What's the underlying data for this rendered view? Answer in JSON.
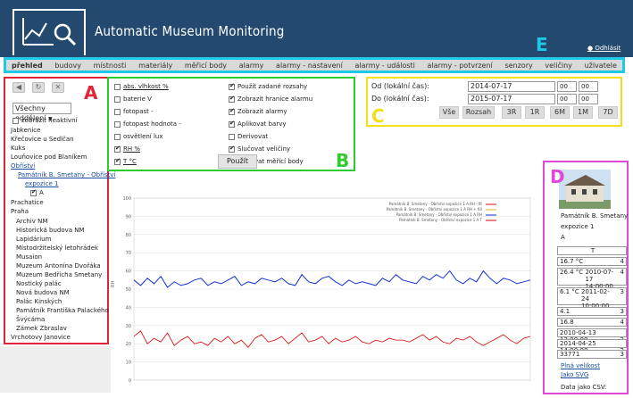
{
  "app": {
    "title": "Automatic Museum Monitoring",
    "logout": "Odhlásit"
  },
  "nav": {
    "items": [
      {
        "label": "přehled",
        "active": true
      },
      {
        "label": "budovy"
      },
      {
        "label": "místnosti"
      },
      {
        "label": "materiály"
      },
      {
        "label": "měřicí body"
      },
      {
        "label": "alarmy"
      },
      {
        "label": "alarmy - nastavení"
      },
      {
        "label": "alarmy - události"
      },
      {
        "label": "alarmy - potvrzení"
      },
      {
        "label": "senzory"
      },
      {
        "label": "veličiny"
      },
      {
        "label": "uživatele"
      }
    ]
  },
  "markers": {
    "a": "A",
    "b": "B",
    "c": "C",
    "d": "D",
    "e": "E"
  },
  "marker_colors": {
    "a": "#e0243a",
    "b": "#2ecc2e",
    "c": "#f2e016",
    "d": "#e04ad8",
    "e": "#1ec8e6"
  },
  "sidebar": {
    "select": "Všechny oddělení",
    "show_inactive": "zobrazit neaktivní",
    "tree": [
      "Jabkenice",
      "Křečovice u Sedlčan",
      "Kuks",
      "Louňovice pod Blaníkem",
      "Obříství",
      "Památník B. Smetany - Obříství",
      "expozice 1",
      "A",
      "Prachatice",
      "Praha",
      "Archiv NM",
      "Historická budova NM",
      "Lapidárium",
      "Místodržitelský letohrádek",
      "Musaion",
      "Muzeum Antonína Dvořáka",
      "Muzeum Bedřicha Smetany",
      "Nostický palác",
      "Nová budova NM",
      "Palác Kinských",
      "Památník Františka Palackého",
      "Švýcárna",
      "Zámek Zbraslav",
      "Vrchotovy Janovice"
    ]
  },
  "options": {
    "left": [
      {
        "label": "abs. vlhkost %",
        "checked": false
      },
      {
        "label": "baterie V",
        "checked": false
      },
      {
        "label": "fotopast -",
        "checked": false
      },
      {
        "label": "fotopast hodnota -",
        "checked": false
      },
      {
        "label": "osvětlení lux",
        "checked": false
      },
      {
        "label": "RH %",
        "checked": true
      },
      {
        "label": "T °C",
        "checked": true
      }
    ],
    "right": [
      {
        "label": "Použít zadané rozsahy",
        "checked": true
      },
      {
        "label": "Zobrazit hranice alarmu",
        "checked": true
      },
      {
        "label": "Zobrazit alarmy",
        "checked": true
      },
      {
        "label": "Aplikovat barvy",
        "checked": true
      },
      {
        "label": "Derivovat",
        "checked": false
      },
      {
        "label": "Slučovat veličiny",
        "checked": true
      },
      {
        "label": "Slučovat měřicí body",
        "checked": true
      }
    ],
    "apply": "Použít"
  },
  "daterange": {
    "from_label": "Od (lokální čas):",
    "to_label": "Do (lokální čas):",
    "from": "2014-07-17",
    "to": "2015-07-17",
    "hour": "00",
    "minute": "00",
    "buttons": [
      "Vše",
      "Rozsah",
      "3R",
      "1R",
      "6M",
      "1M",
      "7D"
    ]
  },
  "chart_data": {
    "type": "line",
    "y_ticks": [
      0,
      10,
      20,
      30,
      40,
      50,
      60,
      70,
      80,
      90,
      100
    ],
    "ylim": [
      0,
      100
    ],
    "ylabel": "RH",
    "series": [
      {
        "name": "Památník B. Smetany - Obříství expozice 1 A RH - fit",
        "color": "#d11"
      },
      {
        "name": "Památník B. Smetany - Obříství expozice 1 A RH + 60",
        "color": "#f0b020"
      },
      {
        "name": "Památník B. Smetany - Obříství expozice 1 A RH",
        "color": "#1030d0"
      },
      {
        "name": "Památník B. Smetany - Obříství expozice 1 A T",
        "color": "#d00"
      }
    ],
    "rh_values": [
      55,
      52,
      56,
      53,
      57,
      51,
      54,
      52,
      53,
      55,
      56,
      52,
      54,
      53,
      55,
      57,
      52,
      54,
      53,
      56,
      55,
      54,
      56,
      53,
      52,
      58,
      54,
      53,
      56,
      57,
      54,
      52,
      55,
      53,
      54,
      53,
      52,
      56,
      54,
      58,
      55,
      54,
      53,
      57,
      55,
      58,
      56,
      60,
      55,
      53,
      56,
      54,
      60,
      56,
      53,
      56,
      55,
      53,
      54,
      55
    ],
    "t_values": [
      24,
      27,
      20,
      23,
      21,
      26,
      19,
      22,
      24,
      20,
      21,
      19,
      23,
      21,
      24,
      20,
      22,
      18,
      23,
      25,
      21,
      22,
      24,
      20,
      23,
      26,
      21,
      22,
      24,
      20,
      23,
      21,
      22,
      24,
      21,
      20,
      22,
      21,
      23,
      22,
      22,
      21,
      23,
      25,
      22,
      24,
      21,
      20,
      23,
      22,
      24,
      21,
      19,
      21,
      23,
      25,
      22,
      20,
      23,
      24
    ]
  },
  "detail": {
    "name": "Památník B. Smetany",
    "room": "expozice 1",
    "point": "A",
    "col_header": "T",
    "rows": [
      {
        "value": "16.7 °C",
        "time": "",
        "n": "4"
      },
      {
        "value": "26.4 °C",
        "time": "2010-07-17 14:00:00",
        "n": "4"
      },
      {
        "value": "6.1 °C",
        "time": "2011-02-24 10:00:00",
        "n": "3"
      },
      {
        "value": "4.1",
        "time": "",
        "n": "3"
      },
      {
        "value": "16.8",
        "time": "",
        "n": "4"
      },
      {
        "value": "2010-04-13 12:00:00",
        "time": "",
        "n": "2"
      },
      {
        "value": "2014-04-25 14:00:00",
        "time": "",
        "n": "2"
      },
      {
        "value": "33771",
        "time": "",
        "n": "3"
      }
    ],
    "full_size": "Plná velikost",
    "as_svg": "Jako SVG",
    "csv": "Data jako CSV:"
  }
}
